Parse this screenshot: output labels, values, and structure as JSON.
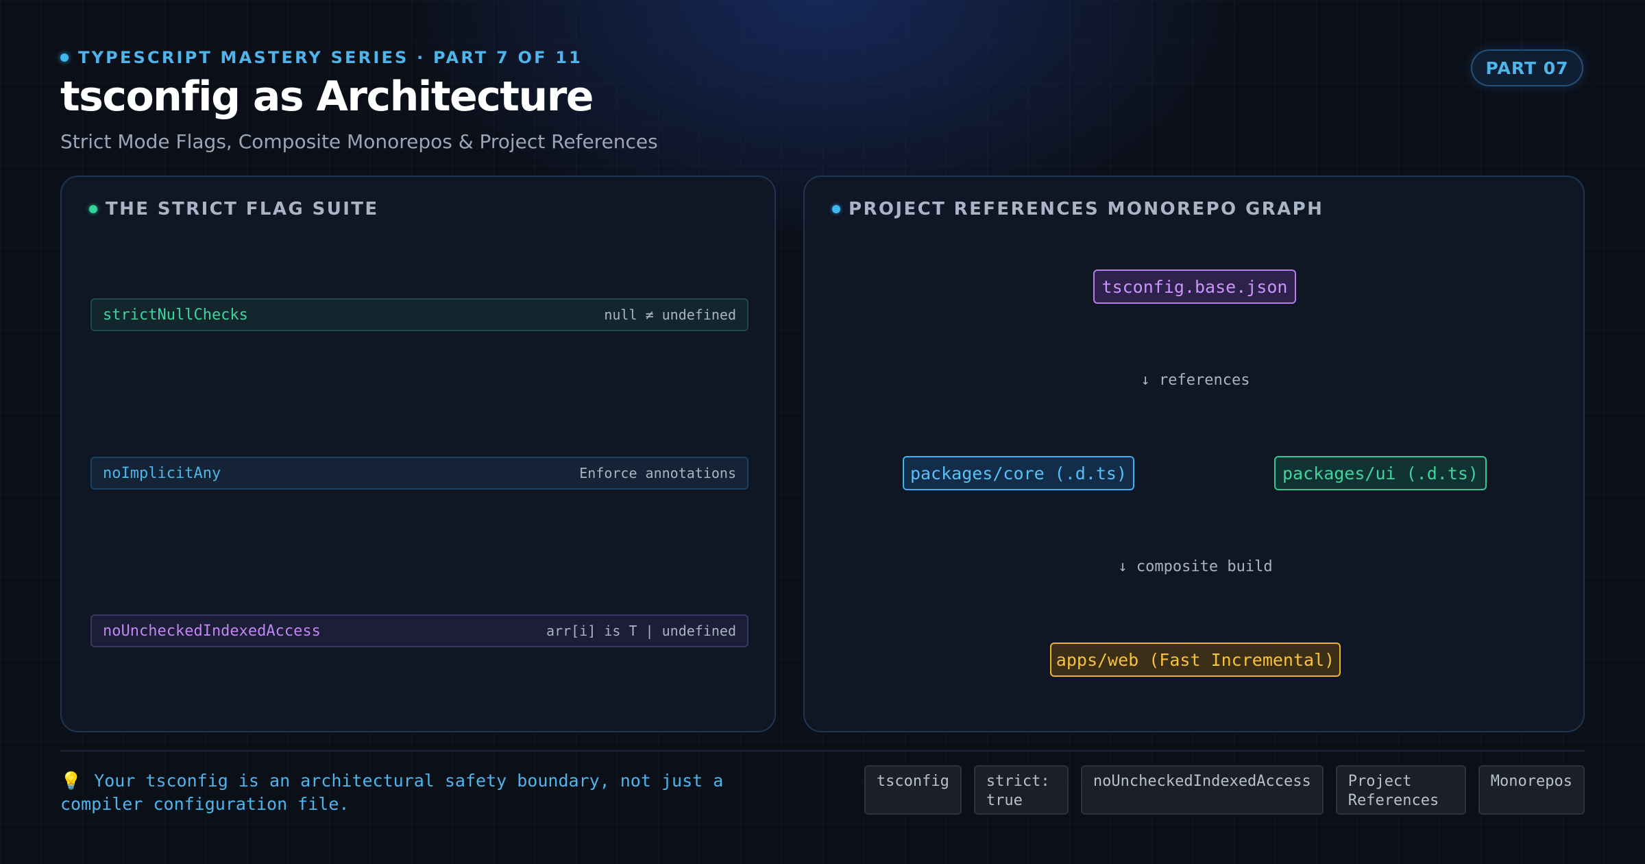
{
  "header": {
    "kicker": "TYPESCRIPT MASTERY SERIES · PART 7 OF 11",
    "title": "tsconfig as Architecture",
    "subtitle": "Strict Mode Flags, Composite Monorepos & Project References",
    "badge": "PART 07"
  },
  "left_panel": {
    "title": "THE STRICT FLAG SUITE",
    "flags": [
      {
        "name": "strictNullChecks",
        "note": "null ≠ undefined",
        "color": "#3fd49c"
      },
      {
        "name": "noImplicitAny",
        "note": "Enforce annotations",
        "color": "#4fb4ea"
      },
      {
        "name": "noUncheckedIndexedAccess",
        "note": "arr[i] is T | undefined",
        "color": "#c186f2"
      }
    ]
  },
  "right_panel": {
    "title": "PROJECT REFERENCES MONOREPO GRAPH",
    "nodes": {
      "base": "tsconfig.base.json",
      "core": "packages/core (.d.ts)",
      "ui": "packages/ui (.d.ts)",
      "web": "apps/web (Fast Incremental)"
    },
    "edges": {
      "references": "↓ references",
      "composite": "↓ composite build"
    }
  },
  "footer": {
    "callout_icon": "lightbulb-icon",
    "callout": "Your tsconfig is an architectural safety boundary, not just a compiler configuration file.",
    "tags": [
      "tsconfig",
      "strict: true",
      "noUncheckedIndexedAccess",
      "Project References",
      "Monorepos"
    ]
  },
  "colors": {
    "background": "#0b0f18",
    "accent_blue": "#4fb4ea",
    "accent_green": "#3fd49c",
    "accent_purple": "#c186f2",
    "accent_yellow": "#f7c13c"
  }
}
